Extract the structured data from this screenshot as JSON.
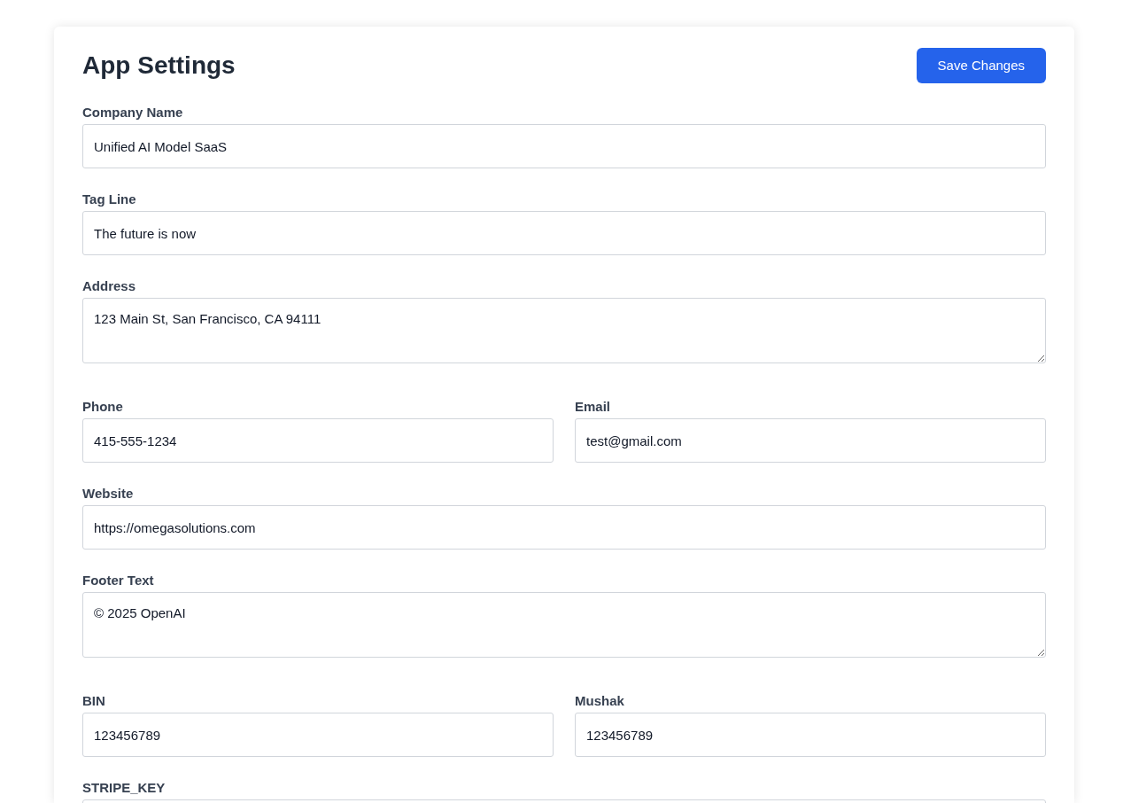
{
  "title": "App Settings",
  "save_button": "Save Changes",
  "rows": [
    {
      "fields": [
        {
          "label": "Company Name",
          "value": "Unified AI Model SaaS",
          "kind": "input"
        }
      ]
    },
    {
      "fields": [
        {
          "label": "Tag Line",
          "value": "The future is now",
          "kind": "input"
        }
      ]
    },
    {
      "fields": [
        {
          "label": "Address",
          "value": "123 Main St, San Francisco, CA 94111",
          "kind": "textarea"
        }
      ]
    },
    {
      "fields": [
        {
          "label": "Phone",
          "value": "415-555-1234",
          "kind": "input"
        },
        {
          "label": "Email",
          "value": "test@gmail.com",
          "kind": "input"
        }
      ]
    },
    {
      "fields": [
        {
          "label": "Website",
          "value": "https://omegasolutions.com",
          "kind": "input"
        }
      ]
    },
    {
      "fields": [
        {
          "label": "Footer Text",
          "value": "© 2025 OpenAI",
          "kind": "textarea"
        }
      ]
    },
    {
      "fields": [
        {
          "label": "BIN",
          "value": "123456789",
          "kind": "input"
        },
        {
          "label": "Mushak",
          "value": "123456789",
          "kind": "input"
        }
      ]
    },
    {
      "fields": [
        {
          "label": "STRIPE_KEY",
          "kind": "input"
        }
      ]
    }
  ]
}
